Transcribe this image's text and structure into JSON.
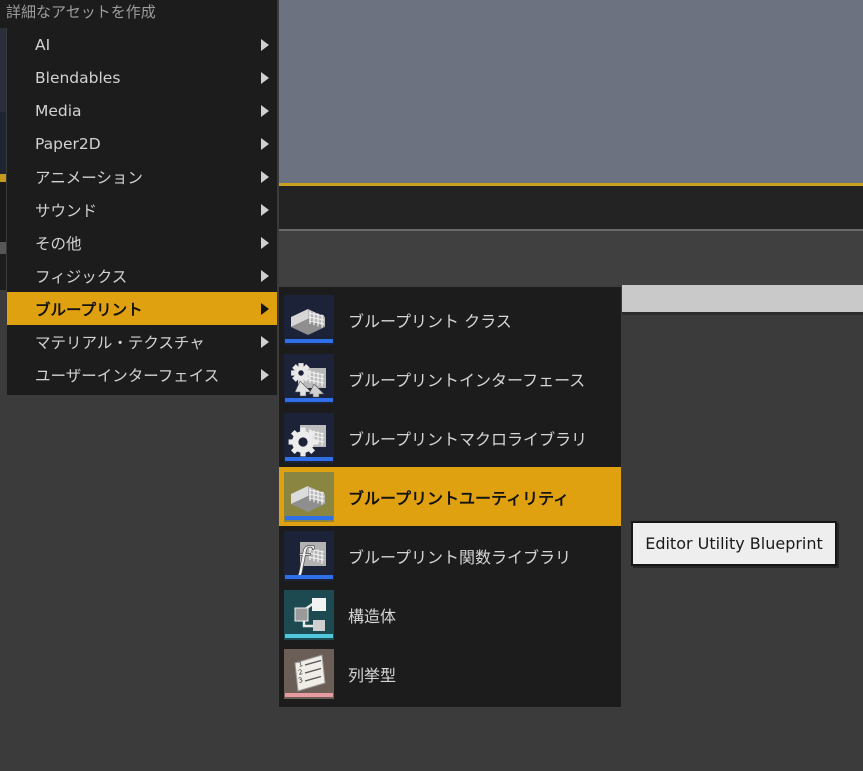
{
  "menu": {
    "heading": "詳細なアセットを作成",
    "selected_index": 8,
    "items": [
      {
        "label": "AI",
        "has_submenu": true
      },
      {
        "label": "Blendables",
        "has_submenu": true
      },
      {
        "label": "Media",
        "has_submenu": true
      },
      {
        "label": "Paper2D",
        "has_submenu": true
      },
      {
        "label": "アニメーション",
        "has_submenu": true
      },
      {
        "label": "サウンド",
        "has_submenu": true
      },
      {
        "label": "その他",
        "has_submenu": true
      },
      {
        "label": "フィジックス",
        "has_submenu": true
      },
      {
        "label": "ブループリント",
        "has_submenu": true
      },
      {
        "label": "マテリアル・テクスチャ",
        "has_submenu": true
      },
      {
        "label": "ユーザーインターフェイス",
        "has_submenu": true
      }
    ]
  },
  "submenu": {
    "selected_index": 3,
    "items": [
      {
        "label": "ブループリント クラス",
        "icon": "blueprint-class-icon",
        "accent": "#2f6fe8"
      },
      {
        "label": "ブループリントインターフェース",
        "icon": "blueprint-interface-icon",
        "accent": "#2f6fe8"
      },
      {
        "label": "ブループリントマクロライブラリ",
        "icon": "blueprint-macro-library-icon",
        "accent": "#2f6fe8"
      },
      {
        "label": "ブループリントユーティリティ",
        "icon": "blueprint-utility-icon",
        "accent": "#2f6fe8"
      },
      {
        "label": "ブループリント関数ライブラリ",
        "icon": "blueprint-function-library-icon",
        "accent": "#2f6fe8"
      },
      {
        "label": "構造体",
        "icon": "struct-icon",
        "accent": "#52c8dc"
      },
      {
        "label": "列挙型",
        "icon": "enum-icon",
        "accent": "#e79aa0"
      }
    ]
  },
  "tooltip": {
    "text": "Editor Utility Blueprint"
  },
  "colors": {
    "highlight": "#e0a110",
    "menu_background": "#1c1c1c",
    "menu_text": "#d2d2d2",
    "viewport": "#6d7280",
    "app_background": "#3b3b3b",
    "tooltip_background": "#eeeeee"
  }
}
